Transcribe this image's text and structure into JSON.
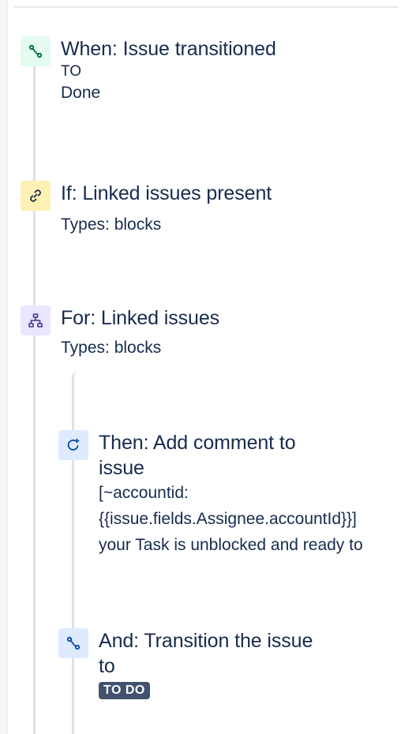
{
  "colors": {
    "trigger_tile": "#e3fcef",
    "condition_tile": "#fff0b3",
    "branch_tile": "#eae6ff",
    "action_tile": "#deebff",
    "lozenge_bg": "#42526e",
    "text": "#172b4d"
  },
  "rule": {
    "trigger": {
      "icon": "transition-icon",
      "title": "When: Issue transitioned",
      "detail_prefix": "TO",
      "detail_value": "Done"
    },
    "condition": {
      "icon": "link-icon",
      "title": "If: Linked issues present",
      "detail": "Types: blocks"
    },
    "branch": {
      "icon": "hierarchy-icon",
      "title": "For: Linked issues",
      "detail": "Types: blocks"
    },
    "action_comment": {
      "icon": "comment-refresh-icon",
      "title_line1": "Then: Add comment to",
      "title_line2": "issue",
      "detail_line1": "[~accountid:",
      "detail_line2": "{{issue.fields.Assignee.accountId}}]",
      "detail_line3": "your Task is unblocked and ready to"
    },
    "action_transition": {
      "icon": "transition-icon",
      "title_line1": "And: Transition the issue",
      "title_line2": "to",
      "status_lozenge": "TO DO"
    }
  }
}
